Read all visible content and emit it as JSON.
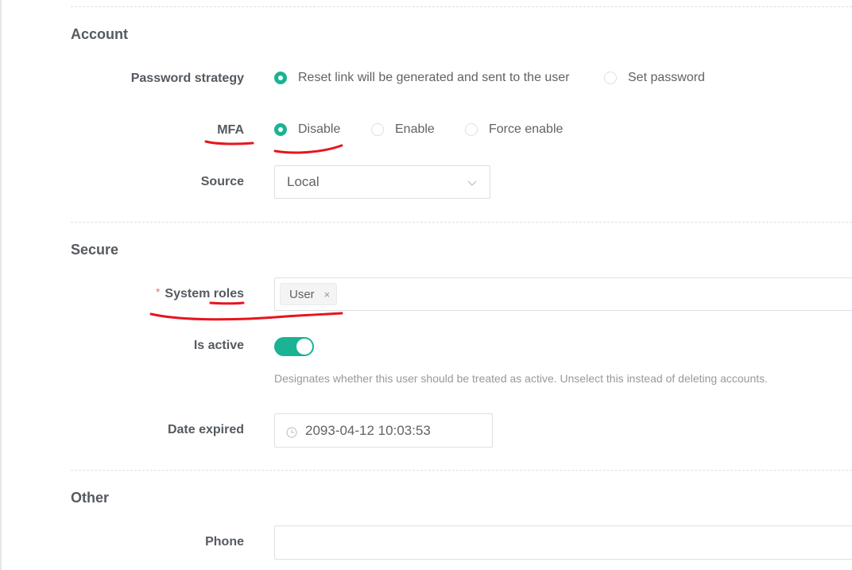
{
  "sections": {
    "account": "Account",
    "secure": "Secure",
    "other": "Other"
  },
  "account": {
    "password_strategy": {
      "label": "Password strategy",
      "options": [
        "Reset link will be generated and sent to the user",
        "Set password"
      ],
      "selected": "Reset link will be generated and sent to the user"
    },
    "mfa": {
      "label": "MFA",
      "options": [
        "Disable",
        "Enable",
        "Force enable"
      ],
      "selected": "Disable"
    },
    "source": {
      "label": "Source",
      "value": "Local"
    }
  },
  "secure": {
    "system_roles": {
      "label": "System roles",
      "required_mark": "*",
      "tags": [
        "User"
      ],
      "tag_remove": "×"
    },
    "is_active": {
      "label": "Is active",
      "value": true,
      "help": "Designates whether this user should be treated as active. Unselect this instead of deleting accounts."
    },
    "date_expired": {
      "label": "Date expired",
      "value": "2093-04-12 10:03:53"
    }
  },
  "other": {
    "phone": {
      "label": "Phone",
      "value": ""
    }
  },
  "colors": {
    "primary": "#1ab394",
    "annotation": "#e8141e",
    "required": "#f56c6c"
  }
}
